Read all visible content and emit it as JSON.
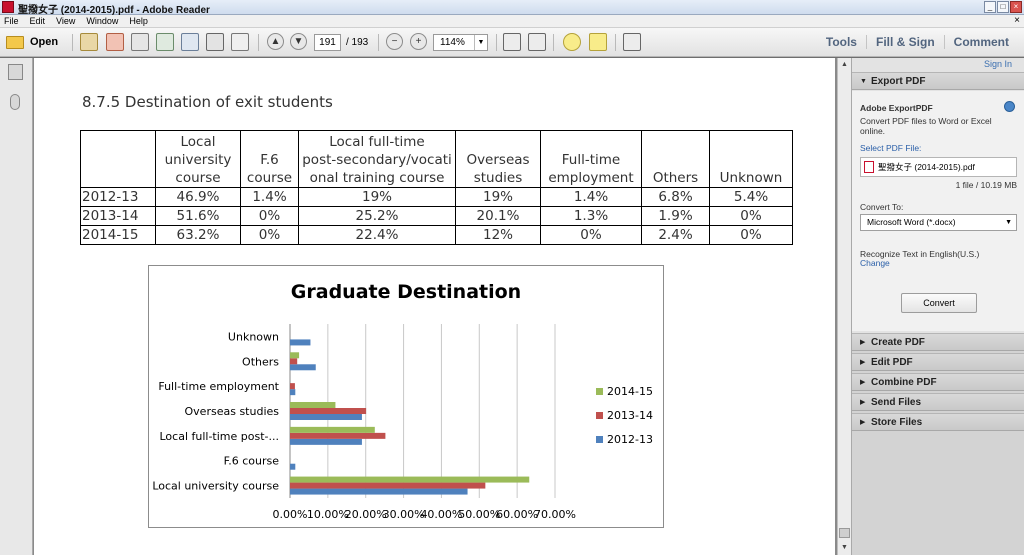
{
  "window": {
    "title": "聖撥女子 (2014-2015).pdf - Adobe Reader"
  },
  "menu": [
    "File",
    "Edit",
    "View",
    "Window",
    "Help"
  ],
  "toolbar": {
    "open_label": "Open",
    "page_current": "191",
    "page_total": "/ 193",
    "zoom": "114%",
    "tabs": [
      "Tools",
      "Fill & Sign",
      "Comment"
    ]
  },
  "document": {
    "section_title": "8.7.5 Destination of exit students",
    "table": {
      "headers": [
        "",
        "Local university course",
        "F.6 course",
        "Local full-time post-secondary/vocational training course",
        "Overseas studies",
        "Full-time employment",
        "Others",
        "Unknown"
      ],
      "header_lines": [
        [],
        [
          "Local",
          "university",
          "course"
        ],
        [
          "F.6",
          "course"
        ],
        [
          "Local full-time",
          "post-secondary/vocati",
          "onal training course"
        ],
        [
          "Overseas",
          "studies"
        ],
        [
          "Full-time",
          "employment"
        ],
        [
          "Others"
        ],
        [
          "Unknown"
        ]
      ],
      "rows": [
        [
          "2012-13",
          "46.9%",
          "1.4%",
          "19%",
          "19%",
          "1.4%",
          "6.8%",
          "5.4%"
        ],
        [
          "2013-14",
          "51.6%",
          "0%",
          "25.2%",
          "20.1%",
          "1.3%",
          "1.9%",
          "0%"
        ],
        [
          "2014-15",
          "63.2%",
          "0%",
          "22.4%",
          "12%",
          "0%",
          "2.4%",
          "0%"
        ]
      ]
    }
  },
  "chart_data": {
    "type": "bar",
    "orientation": "horizontal",
    "title": "Graduate Destination",
    "categories": [
      "Local university course",
      "F.6 course",
      "Local full-time post-...",
      "Overseas studies",
      "Full-time employment",
      "Others",
      "Unknown"
    ],
    "series": [
      {
        "name": "2012-13",
        "color": "#4f81bd",
        "values": [
          46.9,
          1.4,
          19,
          19,
          1.4,
          6.8,
          5.4
        ]
      },
      {
        "name": "2013-14",
        "color": "#c0504d",
        "values": [
          51.6,
          0,
          25.2,
          20.1,
          1.3,
          1.9,
          0
        ]
      },
      {
        "name": "2014-15",
        "color": "#9bbb59",
        "values": [
          63.2,
          0,
          22.4,
          12,
          0,
          2.4,
          0
        ]
      }
    ],
    "x_ticks": [
      "0.00%",
      "10.00%",
      "20.00%",
      "30.00%",
      "40.00%",
      "50.00%",
      "60.00%",
      "70.00%"
    ],
    "xlim": [
      0,
      70
    ],
    "legend_position": "right",
    "legend_order": [
      "2014-15",
      "2013-14",
      "2012-13"
    ],
    "grid": true
  },
  "side_panel": {
    "sign_in": "Sign In",
    "export_header": "Export PDF",
    "export_title": "Adobe ExportPDF",
    "export_desc_1": "Convert PDF files to Word or Excel",
    "export_desc_2": "online.",
    "select_file_label": "Select PDF File:",
    "file_name": "聖撥女子 (2014-2015).pdf",
    "file_info": "1 file / 10.19 MB",
    "convert_to_label": "Convert To:",
    "convert_to_value": "Microsoft Word (*.docx)",
    "recognize_text": "Recognize Text in English(U.S.)",
    "change_link": "Change",
    "convert_button": "Convert",
    "sections": [
      "Create PDF",
      "Edit PDF",
      "Combine PDF",
      "Send Files",
      "Store Files"
    ]
  }
}
